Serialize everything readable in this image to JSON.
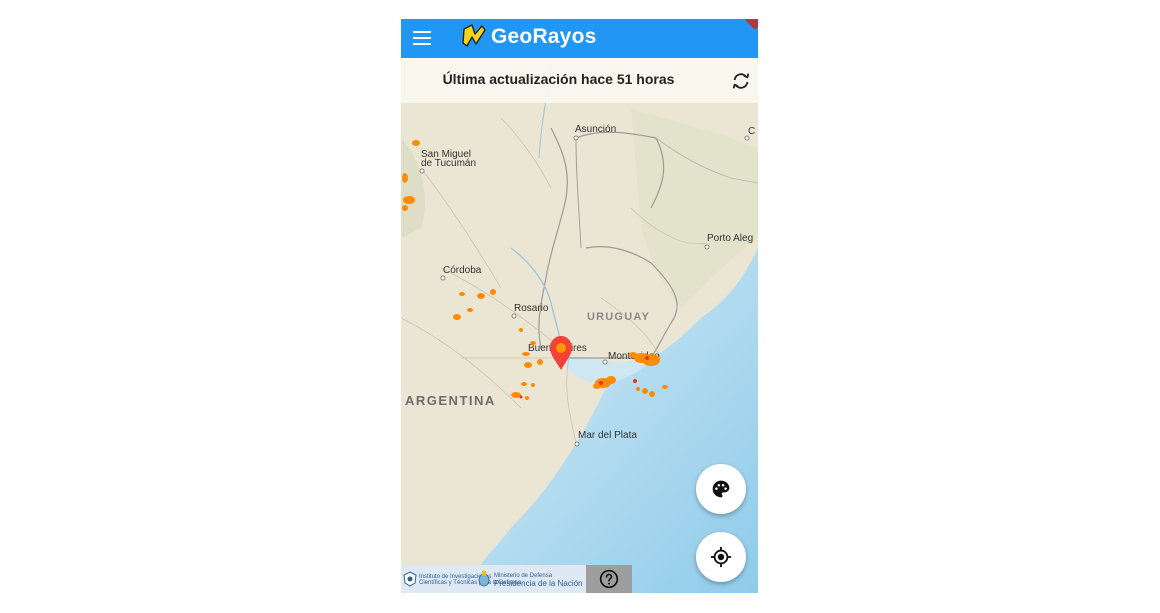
{
  "app": {
    "title": "GeoRayos",
    "brand_color": "#2196f3"
  },
  "icons": {
    "menu": "hamburger-menu-icon",
    "logo": "lightning-logo-icon",
    "refresh": "refresh-icon",
    "palette": "palette-icon",
    "locate": "my-location-icon",
    "help": "help-circle-icon"
  },
  "status": {
    "last_update": "Última actualización hace 51 horas"
  },
  "map": {
    "labels": {
      "asuncion": "Asunción",
      "tucuman_line1": "San Miguel",
      "tucuman_line2": "de Tucumán",
      "porto_alegre": "Porto Aleg",
      "cordoba": "Córdoba",
      "rosario": "Rosario",
      "uruguay": "URUGUAY",
      "buenos_aires": "Buenos Aires",
      "montevideo": "Montevideo",
      "argentina": "ARGENTINA",
      "mar_del_plata": "Mar del Plata"
    },
    "strike_color": "#ff8c00"
  },
  "footer": {
    "institute_line1": "Instituto de Investigaciones",
    "institute_line2": "Científicas y Técnicas para la Defensa",
    "ministry": "Ministerio de Defensa",
    "presidency": "Presidencia de la Nación"
  }
}
